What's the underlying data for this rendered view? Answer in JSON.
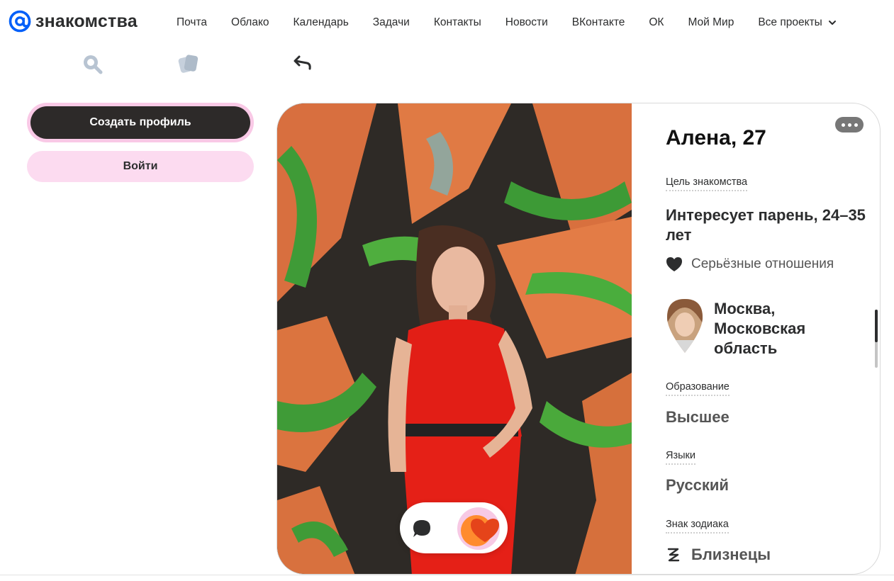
{
  "header": {
    "logo_text": "знакомства",
    "nav": [
      "Почта",
      "Облако",
      "Календарь",
      "Задачи",
      "Контакты",
      "Новости",
      "ВКонтакте",
      "ОК",
      "Мой Мир"
    ],
    "more_label": "Все проекты"
  },
  "toolbar": {
    "icons": [
      "search-icon",
      "cards-icon",
      "back-arrow-icon"
    ]
  },
  "sidebar": {
    "create_profile": "Создать профиль",
    "login": "Войти"
  },
  "profile": {
    "name_age": "Алена, 27",
    "goal_label": "Цель знакомства",
    "goal_value": "Интересует парень, 24–35 лет",
    "relationship": "Серьёзные отношения",
    "location": "Москва, Московская область",
    "education_label": "Образование",
    "education_value": "Высшее",
    "languages_label": "Языки",
    "languages_value": "Русский",
    "zodiac_label": "Знак зодиака",
    "zodiac_value": "Близнецы"
  },
  "colors": {
    "brand_blue": "#005ff9",
    "accent_pink": "#f9c9e6",
    "button_dark": "#2d2a29",
    "like_orange": "#ff5f1f"
  }
}
